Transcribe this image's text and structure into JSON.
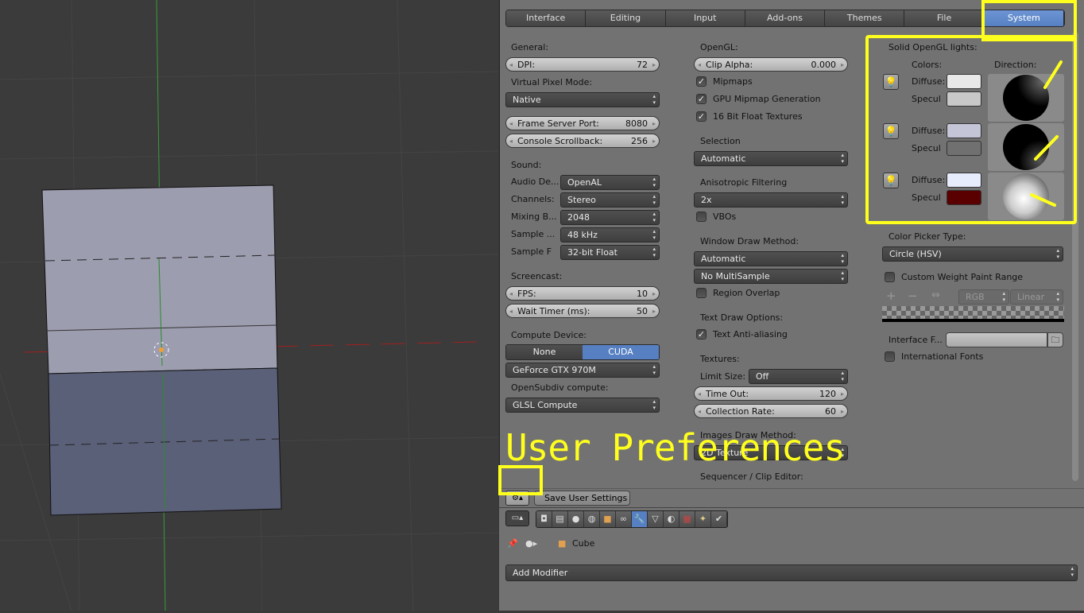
{
  "tabs": [
    {
      "label": "Interface"
    },
    {
      "label": "Editing"
    },
    {
      "label": "Input"
    },
    {
      "label": "Add-ons"
    },
    {
      "label": "Themes"
    },
    {
      "label": "File"
    },
    {
      "label": "System",
      "active": true
    }
  ],
  "col1": {
    "general": "General:",
    "dpi_label": "DPI:",
    "dpi": "72",
    "vpm_label": "Virtual Pixel Mode:",
    "vpm": "Native",
    "fsp_label": "Frame Server Port:",
    "fsp": "8080",
    "cs_label": "Console Scrollback:",
    "cs": "256",
    "sound": "Sound:",
    "audio_label": "Audio De...",
    "audio": "OpenAL",
    "channels_label": "Channels:",
    "channels": "Stereo",
    "mixing_label": "Mixing B...",
    "mixing": "2048",
    "rate_label": "Sample ...",
    "rate": "48 kHz",
    "format_label": "Sample F",
    "format": "32-bit Float",
    "screencast": "Screencast:",
    "fps_label": "FPS:",
    "fps": "10",
    "wait_label": "Wait Timer (ms):",
    "wait": "50",
    "compute": "Compute Device:",
    "none": "None",
    "cuda": "CUDA",
    "gpu": "GeForce GTX 970M",
    "osd_label": "OpenSubdiv compute:",
    "osd": "GLSL Compute"
  },
  "col2": {
    "opengl": "OpenGL:",
    "clip_label": "Clip Alpha:",
    "clip": "0.000",
    "mipmaps": "Mipmaps",
    "gpu_mip": "GPU Mipmap Generation",
    "float16": "16 Bit Float Textures",
    "selection": "Selection",
    "selection_val": "Automatic",
    "aniso": "Anisotropic Filtering",
    "aniso_val": "2x",
    "vbos": "VBOs",
    "wdm": "Window Draw Method:",
    "wdm_val": "Automatic",
    "multisample": "No MultiSample",
    "region": "Region Overlap",
    "text_draw": "Text Draw Options:",
    "text_aa": "Text Anti-aliasing",
    "textures": "Textures:",
    "limit_label": "Limit Size:",
    "limit": "Off",
    "timeout_label": "Time Out:",
    "timeout": "120",
    "collection_label": "Collection Rate:",
    "collection": "60",
    "images_draw": "Images Draw Method:",
    "images_val": "2D Texture",
    "sequencer": "Sequencer / Clip Editor:"
  },
  "col3": {
    "lights": "Solid OpenGL lights:",
    "colors": "Colors:",
    "direction": "Direction:",
    "diffuse": "Diffuse:",
    "specular": "Specul",
    "light_colors": [
      {
        "diffuse": "#e8e8e8",
        "specular": "#c8c8c8"
      },
      {
        "diffuse": "#c4c6d8",
        "specular": "#707070"
      },
      {
        "diffuse": "#e6ecfc",
        "specular": "#5a0000"
      }
    ],
    "cpt_label": "Color Picker Type:",
    "cpt": "Circle (HSV)",
    "cwpr": "Custom Weight Paint Range",
    "rgb": "RGB",
    "linear": "Linear",
    "font_label": "Interface F...",
    "intl": "International Fonts"
  },
  "footer": {
    "save": "Save User Settings"
  },
  "properties": {
    "object": "Cube",
    "add_modifier": "Add Modifier"
  },
  "annotation": {
    "text": "User Preferences",
    "color": "#ffff1e"
  },
  "colors": {
    "accent": "#5680c2",
    "panel": "#727272"
  }
}
